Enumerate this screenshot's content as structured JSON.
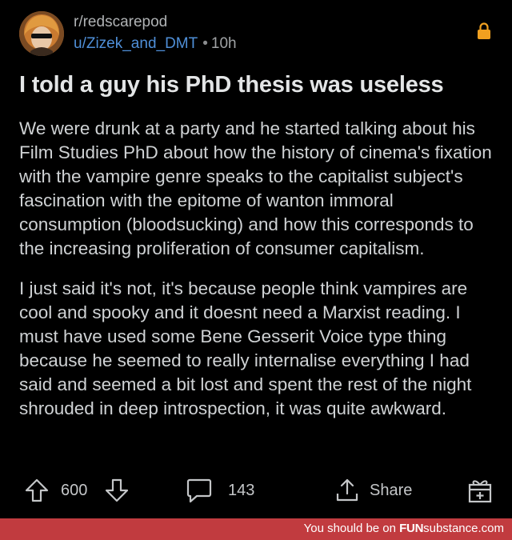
{
  "post": {
    "subreddit": "r/redscarepod",
    "username": "u/Zizek_and_DMT",
    "separator": "•",
    "age": "10h",
    "title": "I told a guy his PhD thesis was useless",
    "paragraphs": [
      "We were drunk at a party and he started talking about his Film Studies PhD about how the history of cinema's fixation with the vampire genre speaks to the capitalist subject's fascination with the epitome of wanton immoral consumption (bloodsucking) and how this corresponds to the increasing proliferation of consumer capitalism.",
      "I just said it's not, it's because people think vampires are cool and spooky and it doesnt need a Marxist reading. I must have used some Bene Gesserit Voice type thing because he seemed to really internalise everything I had said and seemed a bit lost and spent the rest of the night shrouded in deep introspection, it was quite awkward."
    ]
  },
  "actions": {
    "vote_count": "600",
    "comment_count": "143",
    "share_label": "Share"
  },
  "footer": {
    "prefix": "You should be on ",
    "brand_bold": "FUN",
    "brand_rest": "substance.com"
  },
  "icons": {
    "upvote": "arrow-up-icon",
    "downvote": "arrow-down-icon",
    "comment": "comment-bubble-icon",
    "share": "share-icon",
    "award": "gift-icon",
    "lock": "lock-icon"
  },
  "colors": {
    "background": "#000000",
    "username": "#4f8fd8",
    "lock": "#f0a020",
    "footer": "#c13b3f"
  }
}
